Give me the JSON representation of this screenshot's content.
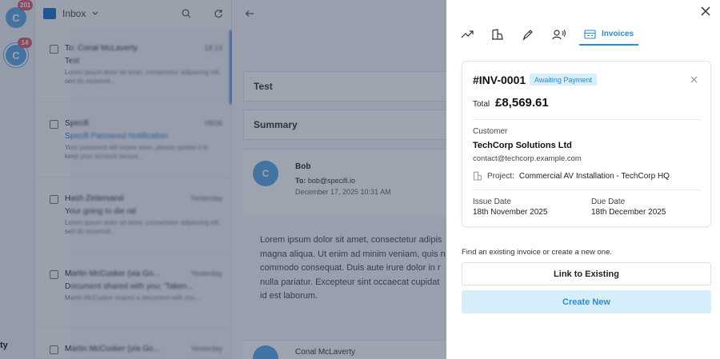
{
  "background": {
    "rail": {
      "accounts": [
        {
          "initial": "C",
          "badge": "201"
        },
        {
          "initial": "C",
          "badge": "14"
        }
      ],
      "bottom_label": "ty"
    },
    "mail_list": {
      "folder": "Inbox",
      "items": [
        {
          "from": "To: Conal McLaverty",
          "date": "18:13",
          "subject": "Test",
          "preview": "Lorem ipsum dolor sit amet, consectetur adipiscing elit, sed do eiusmod..."
        },
        {
          "from": "Specifi",
          "date": "08/06",
          "subject": "Specifi Password Notification",
          "preview": "Your password will expire soon, please update it to keep your account secure..."
        },
        {
          "from": "Hash Zeitersand",
          "date": "Yesterday",
          "subject": "Your going to die rat",
          "preview": "Lorem ipsum dolor sit amet, consectetur adipiscing elit, sed do eiusmod..."
        },
        {
          "from": "Martin McCusker (via Go...",
          "date": "Yesterday",
          "subject": "Document shared with you: 'Taken...",
          "preview": "Martin McCusker shared a document with you..."
        },
        {
          "from": "Martin McCusker (via Go...",
          "date": "Yesterday",
          "subject": "",
          "preview": ""
        }
      ]
    },
    "reading": {
      "rows": [
        "Test",
        "Summary"
      ],
      "sender_initial": "C",
      "sender": "Bob",
      "to_label": "To:",
      "to": "bob@specifi.io",
      "date": "December 17, 2025 10:31 AM",
      "body": "Lorem ipsum dolor sit amet, consectetur adipis\nmagna aliqua. Ut enim ad minim veniam, quis n\ncommodo consequat. Duis aute irure dolor in r\nnulla pariatur. Excepteur sint occaecat cupidat\nid est laborum.",
      "next_sender": "Conal McLaverty"
    }
  },
  "panel": {
    "tabs": [
      {
        "name": "trend",
        "icon": "trend-icon"
      },
      {
        "name": "buildings",
        "icon": "buildings-icon"
      },
      {
        "name": "pen",
        "icon": "pen-icon"
      },
      {
        "name": "contact",
        "icon": "contact-voice-icon"
      },
      {
        "name": "invoices",
        "icon": "invoice-icon",
        "label": "Invoices",
        "active": true
      }
    ],
    "invoice": {
      "number": "#INV-0001",
      "status": "Awaiting Payment",
      "total_label": "Total",
      "total": "£8,569.61",
      "customer_label": "Customer",
      "customer_name": "TechCorp Solutions Ltd",
      "customer_email": "contact@techcorp.example.com",
      "project_label": "Project:",
      "project": "Commercial AV Installation - TechCorp HQ",
      "issue_label": "Issue Date",
      "issue_date": "18th November 2025",
      "due_label": "Due Date",
      "due_date": "18th December 2025"
    },
    "helper_text": "Find an existing invoice or create a new one.",
    "link_button": "Link to Existing",
    "create_button": "Create New"
  },
  "colors": {
    "accent": "#2b8ad6",
    "badge_bg": "#d9eefb",
    "create_bg": "#d6eef9",
    "notification": "#e25c6a",
    "avatar": "#5aa7e6"
  }
}
